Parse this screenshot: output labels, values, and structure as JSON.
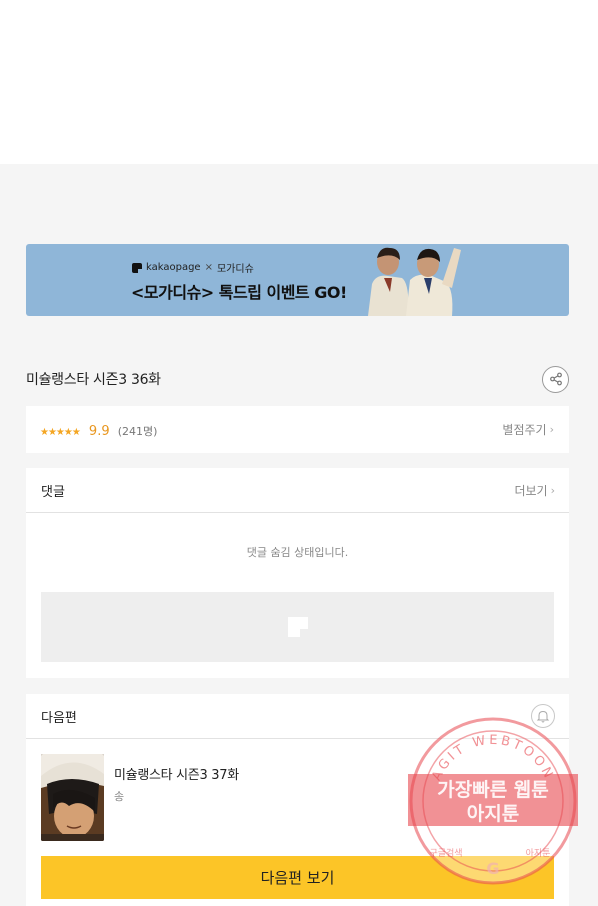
{
  "banner": {
    "brand": "kakaopage",
    "separator": "×",
    "partner": "모가디슈",
    "title": "<모가디슈> 톡드립 이벤트 GO!"
  },
  "episode": {
    "title": "미슐랭스타 시즌3 36화",
    "share_icon": "share-icon"
  },
  "rating": {
    "stars": "★★★★★",
    "score": "9.9",
    "count": "(241명)",
    "rate_label": "별점주기"
  },
  "comments": {
    "label": "댓글",
    "more_label": "더보기",
    "hidden_message": "댓글 숨김 상태입니다."
  },
  "next": {
    "label": "다음편",
    "bell_icon": "bell-icon",
    "title": "미슐랭스타 시즌3 37화",
    "author": "송",
    "button_label": "다음편 보기"
  },
  "watermark": {
    "ring_text": "AGIT WEBTOON",
    "line1": "가장빠른 웹툰",
    "line2": "아지툰",
    "bottom_left": "구글검색",
    "bottom_right": "아지툰",
    "center_letter": "G"
  },
  "colors": {
    "accent_yellow": "#fcc527",
    "star": "#f4a623",
    "banner_bg": "#8fb6d8",
    "watermark_red": "#e8474f"
  }
}
